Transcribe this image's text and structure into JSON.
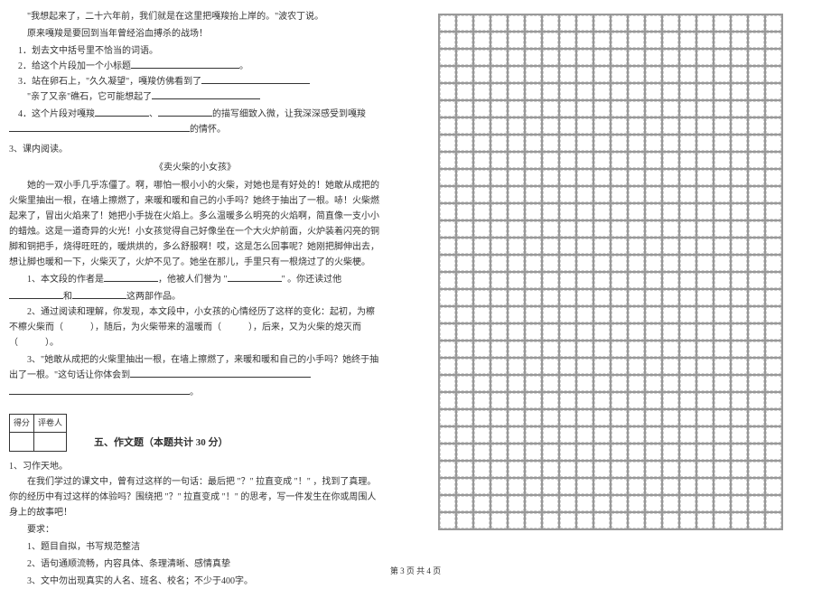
{
  "passage1": {
    "line1": "\"我想起来了，二十六年前，我们就是在这里把嘎羧抬上岸的。\"波农丁说。",
    "line2": "原来嘎羧是要回到当年曾经浴血搏杀的战场！",
    "q1": "1．划去文中括号里不恰当的词语。",
    "q2": "2．给这个片段加一个小标题",
    "q3a": "3．站在卵石上，\"久久凝望\"，嘎羧仿佛看到了",
    "q3b": "\"亲了又亲\"礁石，它可能想起了",
    "q4a": "4．这个片段对嘎羧",
    "q4b": "的描写细致入微，让我深深感受到嘎羧",
    "q4c": "的情怀。"
  },
  "passage2": {
    "heading": "3、课内阅读。",
    "title": "《卖火柴的小女孩》",
    "text": "她的一双小手几乎冻僵了。啊，哪怕一根小小的火柴，对她也是有好处的！她敢从成把的火柴里抽出一根，在墙上擦燃了，来暖和暖和自己的小手吗？她终于抽出了一根。哧！火柴燃起来了，冒出火焰来了！她把小手拢在火焰上。多么温暖多么明亮的火焰啊，简直像一支小小的蜡烛。这是一道奇异的火光！小女孩觉得自己好像坐在一个大火炉前面，火炉装着闪亮的铜脚和铜把手，烧得旺旺的，暖烘烘的，多么舒服啊！哎，这是怎么回事呢？她刚把脚伸出去，想让脚也暖和一下，火柴灭了，火炉不见了。她坐在那儿，手里只有一根烧过了的火柴梗。",
    "q1a": "1、本文段的作者是",
    "q1b": "，他被人们誉为 \"",
    "q1c": "\" 。你还读过他",
    "q1d": "和",
    "q1e": "这两部作品。",
    "q2": "2、通过阅读和理解，你发现，本文段中，小女孩的心情经历了这样的变化：起初，为檫不檫火柴而（　　　），随后，为火柴带来的温暖而（　　　），后来，又为火柴的熄灭而（　　　）。",
    "q3a": "3、\"她敢从成把的火柴里抽出一根，在墙上擦燃了，来暖和暖和自己的小手吗？她终于抽出了一根。\"这句话让你体会到",
    "q3b": "。"
  },
  "section5": {
    "score_h1": "得分",
    "score_h2": "评卷人",
    "title": "五、作文题（本题共计 30 分）",
    "heading": "1、习作天地。",
    "text": "在我们学过的课文中，曾有过这样的一句话：最后把 \"？\" 拉直变成 \"！\" ，找到了真理。你的经历中有过这样的体验吗？围绕把 \"？\" 拉直变成 \"！\" 的思考，写一件发生在你或周围人身上的故事吧！",
    "req_label": "要求：",
    "req1": "1、题目自拟，书写规范整洁",
    "req2": "2、语句通顺流畅，内容具体、条理清晰、感情真挚",
    "req3": "3、文中勿出现真实的人名、班名、校名；不少于400字。"
  },
  "footer": "第 3 页 共 4 页"
}
